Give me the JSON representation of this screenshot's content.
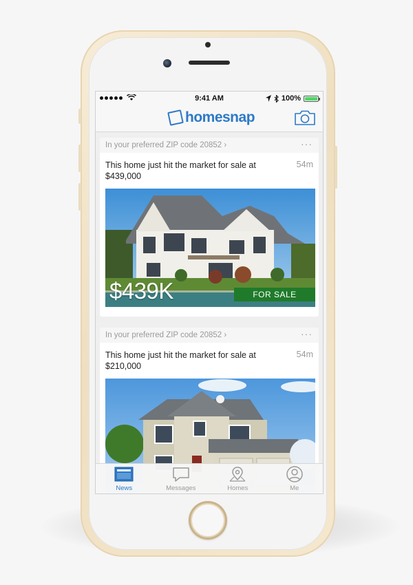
{
  "status_bar": {
    "time": "9:41 AM",
    "battery": "100%"
  },
  "app": {
    "logo_text": "homesnap",
    "brand_color": "#2d79c7"
  },
  "feed": [
    {
      "zip_label": "In your preferred ZIP code 20852 ›",
      "more": "···",
      "headline": "This home just hit the market for sale at $439,000",
      "age": "54m",
      "price_overlay": "$439K",
      "badge": "FOR SALE"
    },
    {
      "zip_label": "In your preferred ZIP code 20852 ›",
      "more": "···",
      "headline": "This home just hit the market for sale at $210,000",
      "age": "54m"
    }
  ],
  "tabs": [
    {
      "label": "News",
      "icon": "news-icon",
      "active": true
    },
    {
      "label": "Messages",
      "icon": "messages-icon",
      "active": false
    },
    {
      "label": "Homes",
      "icon": "map-pin-icon",
      "active": false
    },
    {
      "label": "Me",
      "icon": "person-icon",
      "active": false
    }
  ]
}
